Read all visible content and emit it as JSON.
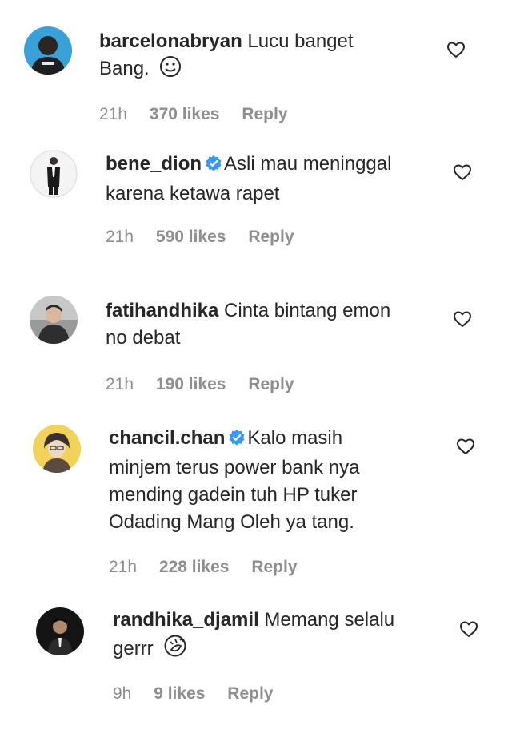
{
  "comments": [
    {
      "username": "barcelonabryan",
      "verified": false,
      "lines": [
        "Lucu banget",
        "Bang."
      ],
      "emoji": "smiling-face",
      "time": "21h",
      "likes": "370 likes",
      "reply": "Reply"
    },
    {
      "username": "bene_dion",
      "verified": true,
      "lines": [
        "Asli mau meninggal",
        "karena ketawa rapet"
      ],
      "time": "21h",
      "likes": "590 likes",
      "reply": "Reply"
    },
    {
      "username": "fatihandhika",
      "verified": false,
      "lines": [
        "Cinta bintang emon",
        "no debat"
      ],
      "time": "21h",
      "likes": "190 likes",
      "reply": "Reply"
    },
    {
      "username": "chancil.chan",
      "verified": true,
      "lines": [
        "Kalo masih",
        "minjem terus power bank nya",
        "mending gadein tuh HP tuker",
        "Odading Mang Oleh ya tang."
      ],
      "time": "21h",
      "likes": "228 likes",
      "reply": "Reply"
    },
    {
      "username": "randhika_djamil",
      "verified": false,
      "lines": [
        "Memang selalu",
        "gerrr"
      ],
      "emoji": "rolling-laughing-face",
      "time": "9h",
      "likes": "9 likes",
      "reply": "Reply"
    }
  ],
  "colors": {
    "text": "#262626",
    "meta": "#8e8e8e",
    "verified": "#3897f0"
  },
  "icons": {
    "like": "heart-outline-icon",
    "verified": "verified-badge-icon"
  }
}
